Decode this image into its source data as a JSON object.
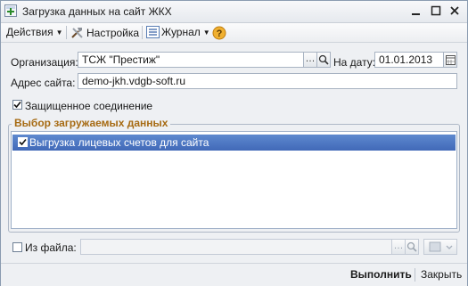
{
  "window": {
    "title": "Загрузка данных на сайт ЖКХ"
  },
  "toolbar": {
    "actions_label": "Действия",
    "settings_label": "Настройка",
    "journal_label": "Журнал",
    "help_symbol": "?"
  },
  "form": {
    "organization_label": "Организация:",
    "organization_value": "ТСЖ \"Престиж\"",
    "date_label": "На дату:",
    "date_value": "01.01.2013",
    "site_label": "Адрес сайта:",
    "site_value": "demo-jkh.vdgb-soft.ru",
    "secure_label": "Защищенное соединение",
    "secure_checked": true
  },
  "group": {
    "title": "Выбор загружаемых данных",
    "items": [
      {
        "label": "Выгрузка лицевых счетов для сайта",
        "checked": true
      }
    ]
  },
  "file": {
    "label": "Из файла:",
    "checked": false,
    "value": ""
  },
  "buttons": {
    "run_label": "Выполнить",
    "close_label": "Закрыть"
  },
  "icons": {
    "app": "app-plus-icon",
    "settings": "tools-icon",
    "journal": "journal-list-icon",
    "help": "help-icon",
    "ellipsis": "ellipsis-icon",
    "search": "search-icon",
    "calendar": "calendar-icon",
    "minimize": "minimize-icon",
    "maximize": "maximize-icon",
    "close": "close-icon"
  },
  "colors": {
    "selection": "#4d79c6",
    "group_title": "#a66a12",
    "help": "#e8a020"
  }
}
